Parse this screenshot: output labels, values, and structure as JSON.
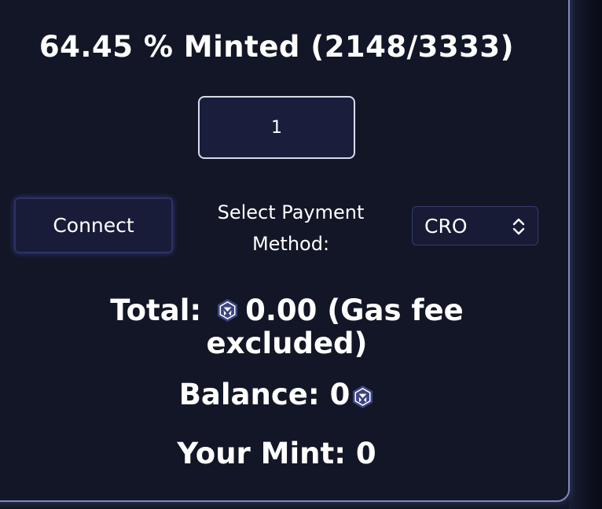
{
  "mint": {
    "progress_text": "64.45 % Minted (2148/3333)",
    "percent": 64.45,
    "minted": 2148,
    "supply": 3333
  },
  "quantity": {
    "value": "1"
  },
  "connect": {
    "label": "Connect"
  },
  "payment": {
    "label_line1": "Select Payment",
    "label_line2": "Method:",
    "selected": "CRO"
  },
  "total": {
    "prefix": "Total:",
    "amount": "0.00",
    "note_line1": "(Gas fee",
    "note_line2": "excluded)"
  },
  "balance": {
    "label": "Balance:",
    "value": "0"
  },
  "your_mint": {
    "text": "Your Mint: 0"
  },
  "icons": {
    "currency": "cro-coin-icon",
    "select": "chevron-up-down-icon"
  },
  "colors": {
    "background": "#121626",
    "panel_border": "#7f87c0",
    "input_bg": "#1a1e3d",
    "text": "#ffffff",
    "icon": "#3a4480"
  }
}
